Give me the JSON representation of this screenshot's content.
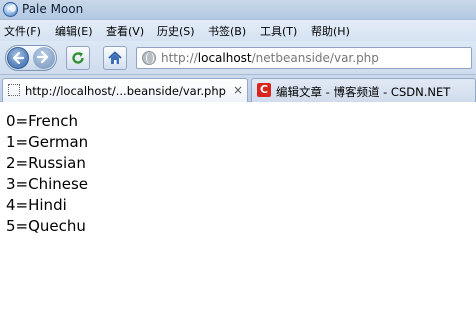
{
  "window": {
    "title": "Pale Moon"
  },
  "menu": [
    "文件(F)",
    "编辑(E)",
    "查看(V)",
    "历史(S)",
    "书签(B)",
    "工具(T)",
    "帮助(H)"
  ],
  "urlbar": {
    "prefix": "http://",
    "host": "localhost",
    "path": "/netbeanside/var.php"
  },
  "tabs": [
    {
      "label": "http://localhost/...beanside/var.php",
      "close": "×"
    },
    {
      "label": "编辑文章 - 博客频道 - CSDN.NET",
      "favicon": "C"
    }
  ],
  "content": {
    "lines": [
      "0=French",
      "1=German",
      "2=Russian",
      "3=Chinese",
      "4=Hindi",
      "5=Quechu"
    ]
  }
}
